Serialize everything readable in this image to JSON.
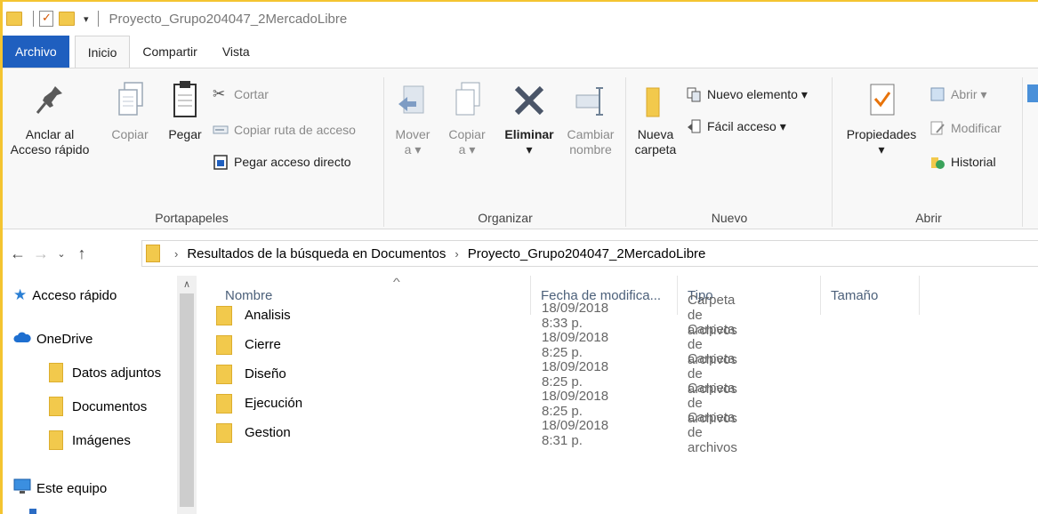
{
  "window": {
    "title": "Proyecto_Grupo204047_2MercadoLibre"
  },
  "tabs": [
    "Archivo",
    "Inicio",
    "Compartir",
    "Vista"
  ],
  "ribbon": {
    "portapapeles": {
      "label": "Portapapeles",
      "pin": "Anclar al\nAcceso rápido",
      "pin_line1": "Anclar al",
      "pin_line2": "Acceso rápido",
      "copy": "Copiar",
      "paste": "Pegar",
      "cut": "Cortar",
      "copy_path": "Copiar ruta de acceso",
      "paste_shortcut": "Pegar acceso directo"
    },
    "organizar": {
      "label": "Organizar",
      "move_line1": "Mover",
      "move_line2": "a ▾",
      "copy_line1": "Copiar",
      "copy_line2": "a ▾",
      "delete_line1": "Eliminar",
      "delete_line2": "▾",
      "rename_line1": "Cambiar",
      "rename_line2": "nombre"
    },
    "nuevo": {
      "label": "Nuevo",
      "new_folder_line1": "Nueva",
      "new_folder_line2": "carpeta",
      "new_item": "Nuevo elemento ▾",
      "easy_access": "Fácil acceso ▾"
    },
    "abrir": {
      "label": "Abrir",
      "properties_line1": "Propiedades",
      "properties_line2": "▾",
      "open": "Abrir ▾",
      "edit": "Modificar",
      "history": "Historial"
    }
  },
  "address": {
    "crumbs": [
      "Resultados de la búsqueda en Documentos",
      "Proyecto_Grupo204047_2MercadoLibre"
    ]
  },
  "navpane": {
    "items": [
      "Acceso rápido",
      "OneDrive",
      "Datos adjuntos",
      "Documentos",
      "Imágenes",
      "Este equipo"
    ]
  },
  "columns": {
    "name": "Nombre",
    "date": "Fecha de modifica...",
    "type": "Tipo",
    "size": "Tamaño"
  },
  "files": [
    {
      "name": "Analisis",
      "date": "18/09/2018 8:33 p.",
      "type": "Carpeta de archivos"
    },
    {
      "name": "Cierre",
      "date": "18/09/2018 8:25 p.",
      "type": "Carpeta de archivos"
    },
    {
      "name": "Diseño",
      "date": "18/09/2018 8:25 p.",
      "type": "Carpeta de archivos"
    },
    {
      "name": "Ejecución",
      "date": "18/09/2018 8:25 p.",
      "type": "Carpeta de archivos"
    },
    {
      "name": "Gestion",
      "date": "18/09/2018 8:31 p.",
      "type": "Carpeta de archivos"
    }
  ],
  "colors": {
    "file_tab": "#1f5fbf",
    "folder": "#f2c94c",
    "header_text": "#4c607a"
  }
}
